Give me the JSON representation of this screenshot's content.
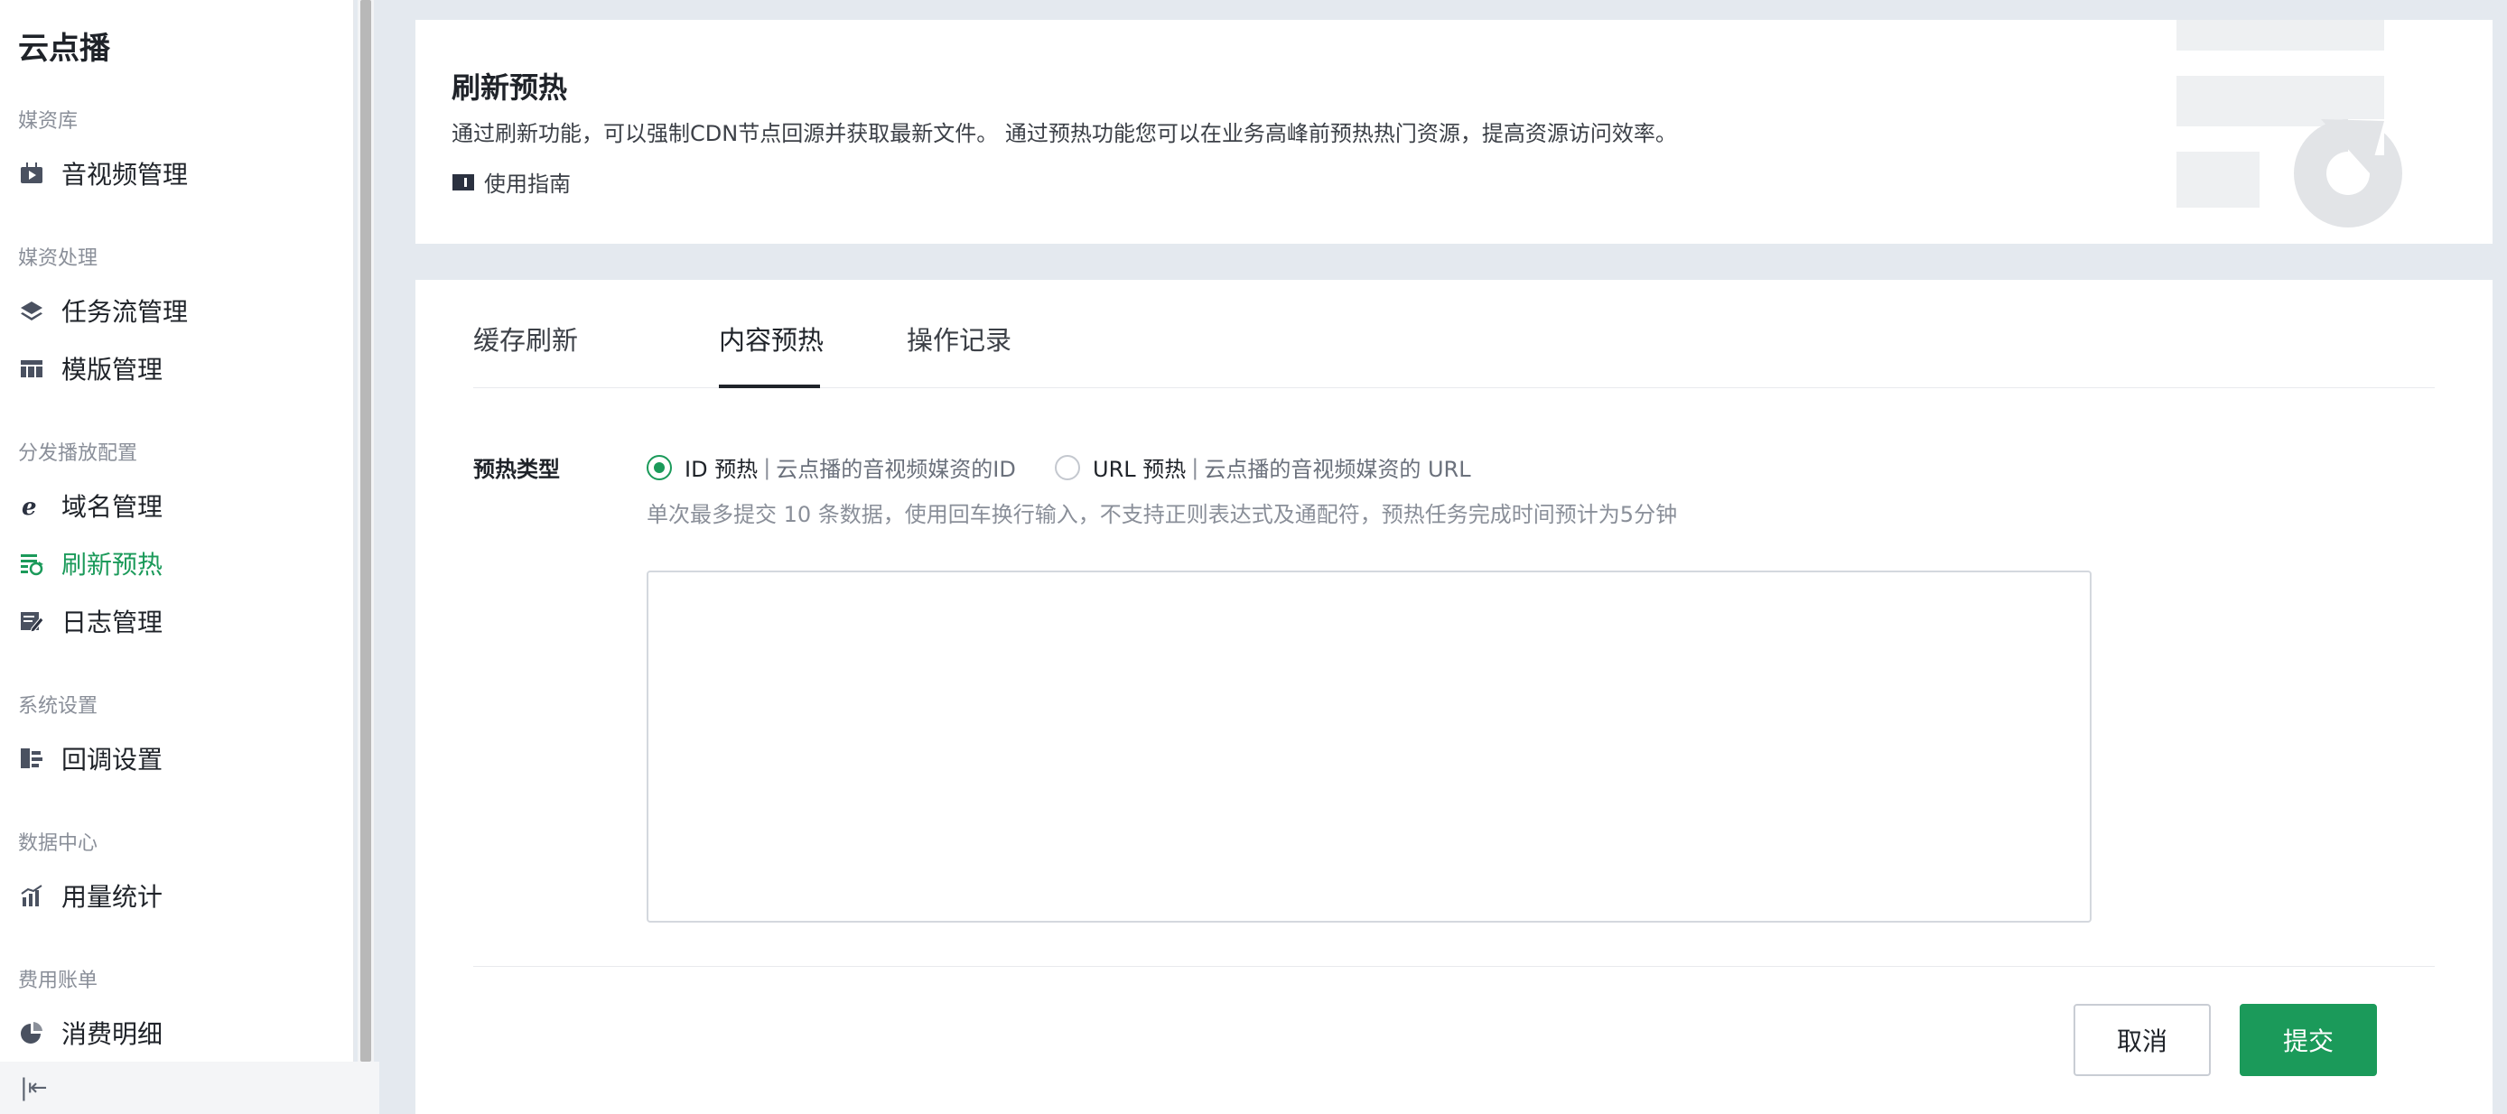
{
  "app": {
    "title": "云点播"
  },
  "sidebar": {
    "groups": [
      {
        "title": "媒资库",
        "items": [
          {
            "label": "音视频管理",
            "icon": "video-library-icon"
          }
        ]
      },
      {
        "title": "媒资处理",
        "items": [
          {
            "label": "任务流管理",
            "icon": "layers-icon"
          },
          {
            "label": "模版管理",
            "icon": "template-table-icon"
          }
        ]
      },
      {
        "title": "分发播放配置",
        "items": [
          {
            "label": "域名管理",
            "icon": "domain-e-icon"
          },
          {
            "label": "刷新预热",
            "icon": "refresh-preheat-icon",
            "active": true
          },
          {
            "label": "日志管理",
            "icon": "log-edit-icon"
          }
        ]
      },
      {
        "title": "系统设置",
        "items": [
          {
            "label": "回调设置",
            "icon": "callback-icon"
          }
        ]
      },
      {
        "title": "数据中心",
        "items": [
          {
            "label": "用量统计",
            "icon": "bar-chart-icon"
          }
        ]
      },
      {
        "title": "费用账单",
        "items": [
          {
            "label": "消费明细",
            "icon": "pie-chart-icon"
          }
        ]
      }
    ],
    "collapse_symbol": "|⇤"
  },
  "header": {
    "title": "刷新预热",
    "description": "通过刷新功能，可以强制CDN节点回源并获取最新文件。 通过预热功能您可以在业务高峰前预热热门资源，提高资源访问效率。",
    "guide_label": "使用指南"
  },
  "tabs": [
    {
      "label": "缓存刷新",
      "active": false
    },
    {
      "label": "内容预热",
      "active": true
    },
    {
      "label": "操作记录",
      "active": false
    }
  ],
  "form": {
    "type_label": "预热类型",
    "options": [
      {
        "label": "ID 预热",
        "separator": "|",
        "desc": "云点播的音视频媒资的ID",
        "checked": true
      },
      {
        "label": "URL 预热",
        "separator": "|",
        "desc": "云点播的音视频媒资的 URL",
        "checked": false
      }
    ],
    "hint": "单次最多提交 10 条数据，使用回车换行输入，不支持正则表达式及通配符，预热任务完成时间预计为5分钟",
    "textarea_value": ""
  },
  "actions": {
    "cancel_label": "取消",
    "submit_label": "提交"
  },
  "colors": {
    "accent": "#1b9a5a",
    "background": "#e4e9ef"
  }
}
